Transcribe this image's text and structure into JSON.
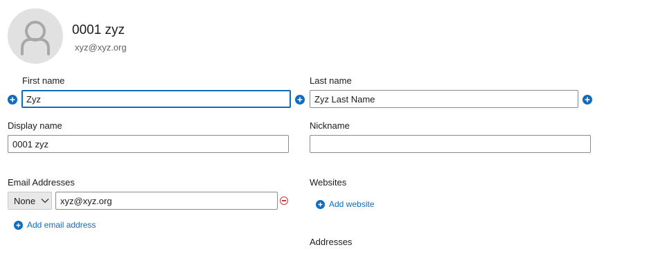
{
  "contact": {
    "display_title": "0001 zyz",
    "email_subtitle": "xyz@xyz.org"
  },
  "fields": {
    "first_name": {
      "label": "First name",
      "value": "Zyz"
    },
    "last_name": {
      "label": "Last name",
      "value": "Zyz Last Name"
    },
    "display_name": {
      "label": "Display name",
      "value": "0001 zyz"
    },
    "nickname": {
      "label": "Nickname",
      "value": ""
    }
  },
  "email": {
    "section_label": "Email Addresses",
    "type_selected": "None",
    "address": "xyz@xyz.org",
    "add_label": "Add email address"
  },
  "websites": {
    "section_label": "Websites",
    "add_label": "Add website"
  },
  "addresses": {
    "section_label": "Addresses"
  },
  "colors": {
    "accent": "#0f6cbd",
    "remove": "#d13438",
    "avatar_bg": "#e1e1e1"
  },
  "icons": [
    "person-icon",
    "add-circle-icon",
    "chevron-down-icon",
    "remove-circle-icon"
  ]
}
